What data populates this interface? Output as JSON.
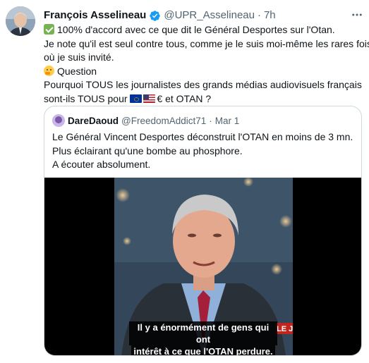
{
  "tweet": {
    "author": {
      "display_name": "François Asselineau",
      "handle": "@UPR_Asselineau",
      "verified": true,
      "avatar_icon": "author-avatar"
    },
    "separator": "·",
    "time": "7h",
    "more_icon": "ellipsis-icon",
    "lines": {
      "l1": "100% d'accord avec ce que dit le Général Desportes sur l'Otan.",
      "l2": "Je note qu'il est seul contre tous, comme je le suis moi-même les rares fois",
      "l3": "où je suis invité.",
      "l4": "Question",
      "l5": "Pourquoi TOUS les journalistes des grands médias audiovisuels français",
      "l6_start": "sont-ils TOUS pour",
      "l6_end": "€ et OTAN ?"
    },
    "emojis": [
      "check-mark-emoji",
      "thinking-face-emoji",
      "eu-flag-emoji",
      "us-flag-emoji"
    ]
  },
  "quoted": {
    "author": {
      "display_name": "DareDaoud",
      "handle": "@FreedomAddict71",
      "avatar_icon": "quoted-avatar"
    },
    "separator": "·",
    "time": "Mar 1",
    "lines": {
      "l1": "Le Général Vincent Desportes déconstruit l'OTAN en moins de 3 mn.",
      "l2": "Plus éclairant qu'une bombe au phosphore.",
      "l3": "A écouter absolument."
    },
    "video": {
      "subtitle_line1": "Il y a énormément de gens qui ont",
      "subtitle_line2": "intérêt à ce que l'OTAN perdure.",
      "corner_text": "LE JO"
    }
  },
  "colors": {
    "text_primary": "#0f1419",
    "text_secondary": "#536471",
    "verified_blue": "#1d9bf0",
    "border": "#cfd9de"
  }
}
